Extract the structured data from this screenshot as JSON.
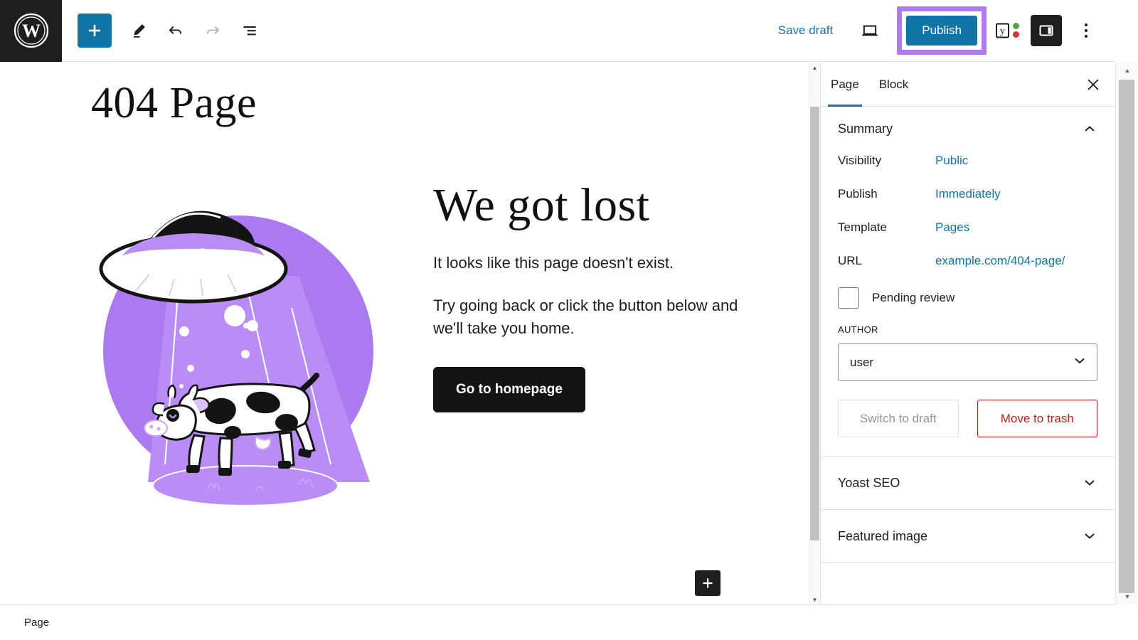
{
  "topbar": {
    "logo_icon": "wordpress-logo-icon",
    "add_block_icon": "plus-icon",
    "tools_icon": "pencil-icon",
    "undo_icon": "undo-arrow-icon",
    "redo_icon": "redo-arrow-icon",
    "list_view_icon": "document-overview-icon",
    "save_draft_label": "Save draft",
    "preview_icon": "laptop-preview-icon",
    "publish_label": "Publish",
    "yoast_icon": "yoast-seo-icon",
    "sidebar_toggle_icon": "settings-panel-icon",
    "options_icon": "three-dots-vertical-icon",
    "highlight_color": "#ae7aef",
    "accent_color": "#1175a8"
  },
  "canvas": {
    "page_title": "404 Page",
    "illustration_name": "ufo-abducting-cow-illustration",
    "heading": "We got lost",
    "paragraph1": "It looks like this page doesn't exist.",
    "paragraph2": "Try going back or click the button below and we'll take you home.",
    "button_label": "Go to homepage",
    "inserter_icon": "plus-icon",
    "illustration_colors": {
      "purple": "#ab7af0",
      "light_purple": "#b98df5",
      "black": "#141414",
      "white": "#ffffff"
    }
  },
  "sidebar": {
    "tabs": [
      {
        "label": "Page",
        "active": true
      },
      {
        "label": "Block",
        "active": false
      }
    ],
    "close_icon": "close-x-icon",
    "summary": {
      "title": "Summary",
      "chevron_icon": "chevron-up-icon",
      "rows": [
        {
          "label": "Visibility",
          "value": "Public"
        },
        {
          "label": "Publish",
          "value": "Immediately"
        },
        {
          "label": "Template",
          "value": "Pages"
        },
        {
          "label": "URL",
          "value": "example.com/404-page/"
        }
      ],
      "pending_review_label": "Pending review",
      "pending_review_checked": false,
      "author_label": "AUTHOR",
      "author_value": "user",
      "author_chevron_icon": "chevron-down-icon",
      "switch_to_draft_label": "Switch to draft",
      "move_to_trash_label": "Move to trash"
    },
    "panels": [
      {
        "title": "Yoast SEO",
        "chevron_icon": "chevron-down-icon"
      },
      {
        "title": "Featured image",
        "chevron_icon": "chevron-down-icon"
      }
    ]
  },
  "bottombar": {
    "breadcrumb": "Page"
  }
}
